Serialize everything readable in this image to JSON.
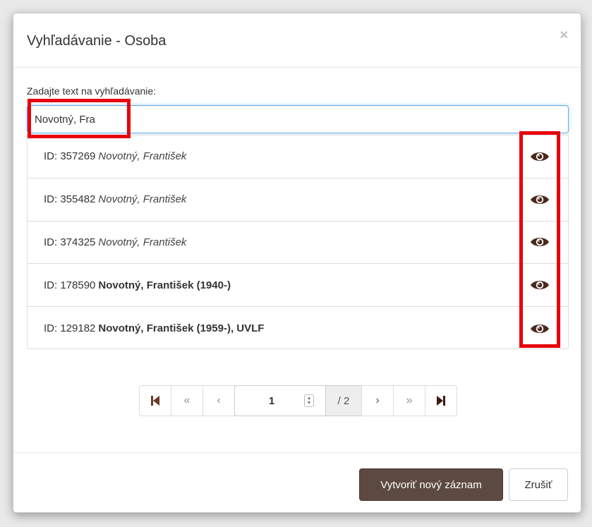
{
  "dialog": {
    "title": "Vyhľadávanie - Osoba",
    "close_symbol": "×"
  },
  "search": {
    "label": "Zadajte text na vyhľadávanie:",
    "value": "Novotný, Fra"
  },
  "results": [
    {
      "id_text": "ID: 357269",
      "name": "Novotný, František",
      "style": "italic",
      "action_icon": "eye-icon"
    },
    {
      "id_text": "ID: 355482",
      "name": "Novotný, František",
      "style": "italic",
      "action_icon": "eye-icon"
    },
    {
      "id_text": "ID: 374325",
      "name": "Novotný, František",
      "style": "italic",
      "action_icon": "eye-icon"
    },
    {
      "id_text": "ID: 178590",
      "name": "Novotný, František (1940-)",
      "style": "bold",
      "action_icon": "eye-icon"
    },
    {
      "id_text": "ID: 129182",
      "name": "Novotný, František (1959-), UVLF",
      "style": "bold",
      "action_icon": "eye-icon"
    }
  ],
  "pagination": {
    "first_icon": "first-page-icon",
    "prev_block_symbol": "«",
    "prev_symbol": "‹",
    "current_page": "1",
    "total_pages": "/ 2",
    "next_symbol": "›",
    "next_block_symbol": "»",
    "last_icon": "last-page-icon"
  },
  "footer": {
    "create_label": "Vytvoriť nový záznam",
    "cancel_label": "Zrušiť"
  },
  "colors": {
    "primary_button": "#5c4a40",
    "eye_icon": "#4a2a1e",
    "highlight_border": "#e8000b",
    "input_focus": "#66afe9"
  }
}
